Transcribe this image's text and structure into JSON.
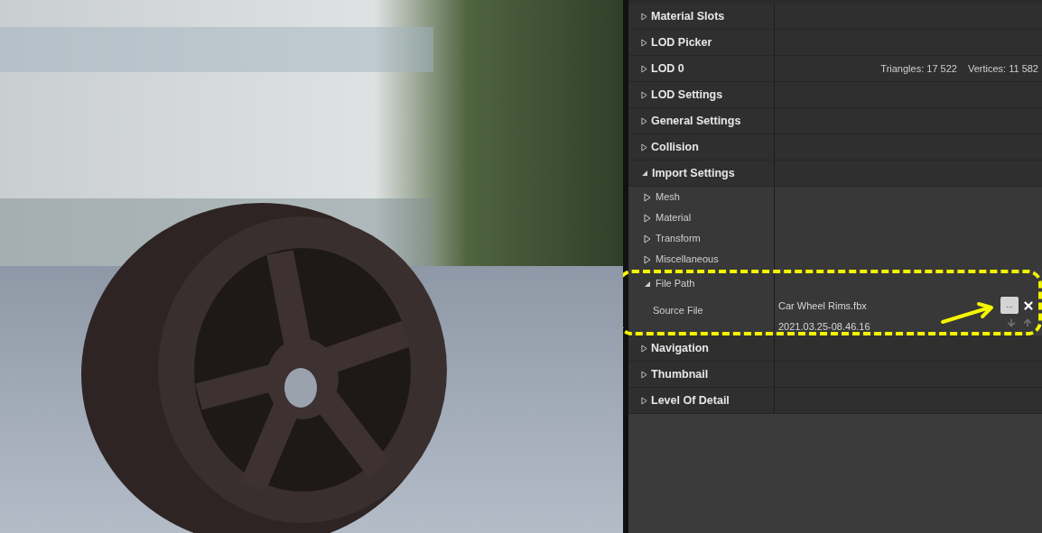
{
  "details": {
    "categories": [
      {
        "label": "Material Slots",
        "expanded": false
      },
      {
        "label": "LOD Picker",
        "expanded": false
      },
      {
        "label": "LOD 0",
        "expanded": false,
        "info": [
          "Triangles: 17 522",
          "Vertices: 11 582"
        ]
      },
      {
        "label": "LOD Settings",
        "expanded": false
      },
      {
        "label": "General Settings",
        "expanded": false
      },
      {
        "label": "Collision",
        "expanded": false
      },
      {
        "label": "Import Settings",
        "expanded": true,
        "children": [
          {
            "label": "Mesh",
            "expanded": false
          },
          {
            "label": "Material",
            "expanded": false
          },
          {
            "label": "Transform",
            "expanded": false
          },
          {
            "label": "Miscellaneous",
            "expanded": false
          },
          {
            "label": "File Path",
            "expanded": true,
            "annotated": true,
            "properties": [
              {
                "name": "Source File",
                "value": "Car Wheel Rims.fbx",
                "timestamp": "2021.03.25-08.46.16",
                "browse": "..."
              }
            ]
          }
        ]
      },
      {
        "label": "Navigation",
        "expanded": false
      },
      {
        "label": "Thumbnail",
        "expanded": false
      },
      {
        "label": "Level Of Detail",
        "expanded": false
      }
    ]
  }
}
